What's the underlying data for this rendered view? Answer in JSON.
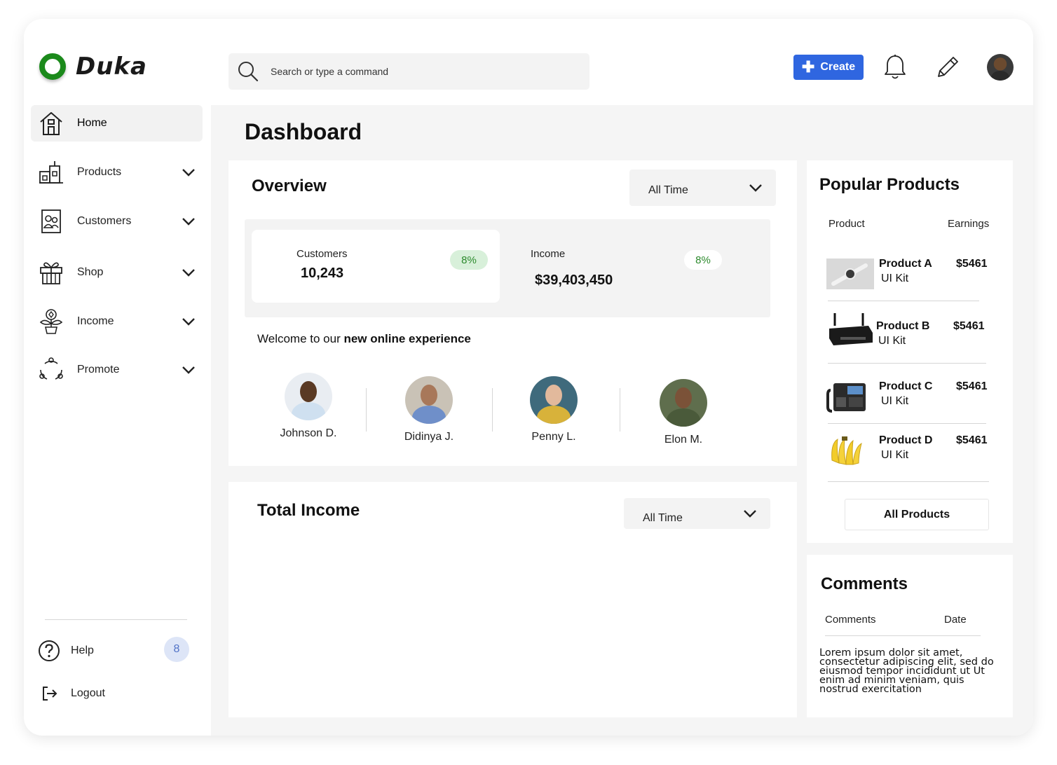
{
  "app": {
    "name": "Duka"
  },
  "search": {
    "placeholder": "Search or type a command"
  },
  "header": {
    "create_label": "Create"
  },
  "sidebar": {
    "items": [
      {
        "label": "Home"
      },
      {
        "label": "Products"
      },
      {
        "label": "Customers"
      },
      {
        "label": "Shop"
      },
      {
        "label": "Income"
      },
      {
        "label": "Promote"
      }
    ],
    "help_label": "Help",
    "help_badge": "8",
    "logout_label": "Logout"
  },
  "main": {
    "title": "Dashboard",
    "overview": {
      "title": "Overview",
      "filter": "All Time",
      "customers": {
        "label": "Customers",
        "value": "10,243",
        "change": "8%"
      },
      "income": {
        "label": "Income",
        "value": "$39,403,450",
        "change": "8%"
      },
      "welcome_prefix": "Welcome  to our ",
      "welcome_bold": "new online experience",
      "members": [
        {
          "name": "Johnson D."
        },
        {
          "name": "Didinya J."
        },
        {
          "name": "Penny L."
        },
        {
          "name": "Elon M."
        }
      ]
    },
    "total_income": {
      "title": "Total Income",
      "filter": "All Time"
    }
  },
  "popular": {
    "title": "Popular Products",
    "col_product": "Product",
    "col_earnings": "Earnings",
    "products": [
      {
        "name": "Product A",
        "sub": "UI Kit",
        "earnings": "$5461"
      },
      {
        "name": "Product B",
        "sub": "UI Kit",
        "earnings": "$5461"
      },
      {
        "name": "Product C",
        "sub": "UI Kit",
        "earnings": "$5461"
      },
      {
        "name": "Product D",
        "sub": "UI Kit",
        "earnings": "$5461"
      }
    ],
    "all_label": "All Products"
  },
  "comments": {
    "title": "Comments",
    "col_comments": "Comments",
    "col_date": "Date",
    "text": "Lorem ipsum dolor sit amet, consectetur adipiscing elit, sed do eiusmod tempor incididunt ut Ut enim ad minim veniam, quis nostrud exercitation"
  },
  "colors": {
    "brand_green": "#1b8a1b",
    "primary_blue": "#2f66e0",
    "badge_green": "#2c8a2c"
  }
}
